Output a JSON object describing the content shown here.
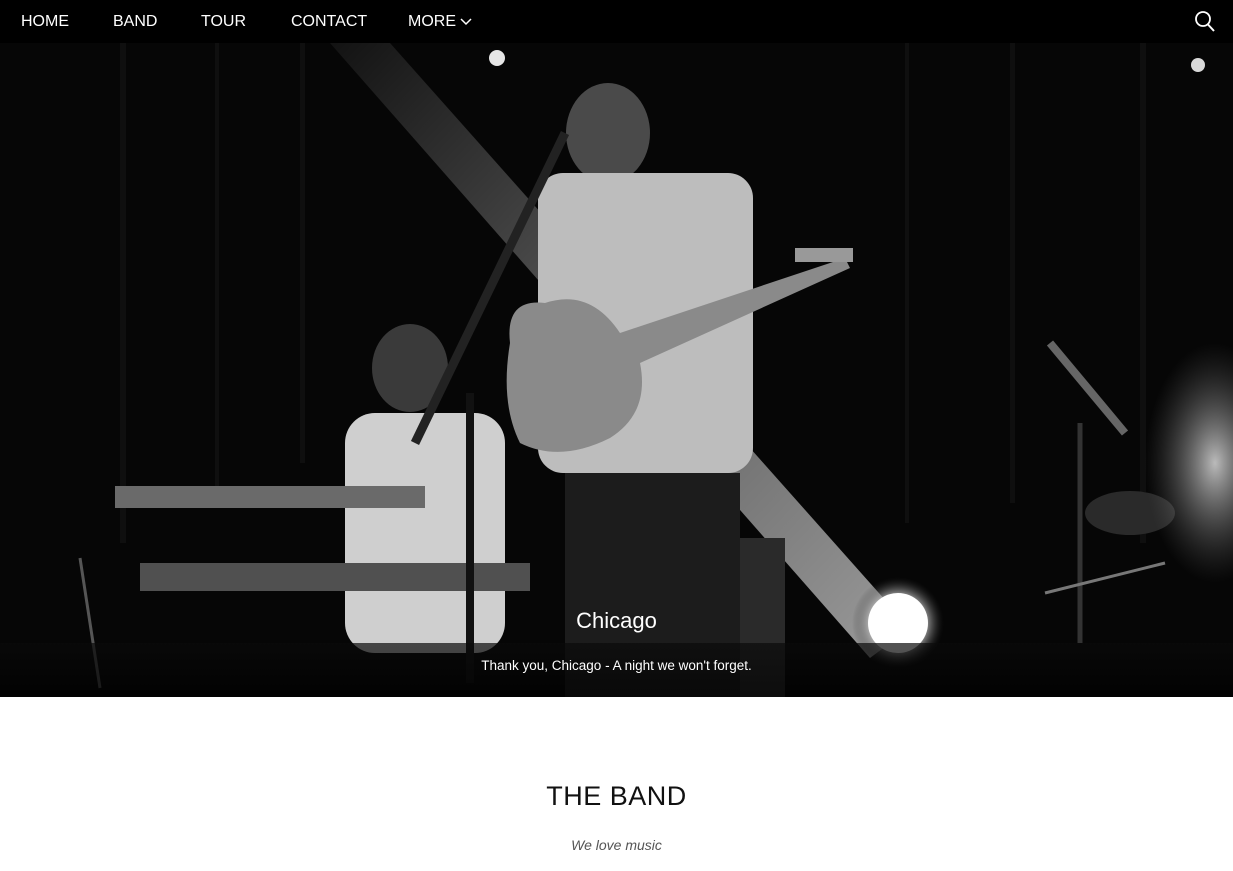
{
  "nav": {
    "items": [
      {
        "label": "HOME"
      },
      {
        "label": "BAND"
      },
      {
        "label": "TOUR"
      },
      {
        "label": "CONTACT"
      }
    ],
    "more_label": "MORE",
    "more_icon": "chevron-down-icon",
    "search_icon": "search-icon"
  },
  "hero": {
    "caption_title": "Chicago",
    "caption_text": "Thank you, Chicago - A night we won't forget."
  },
  "band": {
    "title": "THE BAND",
    "subtitle": "We love music"
  }
}
